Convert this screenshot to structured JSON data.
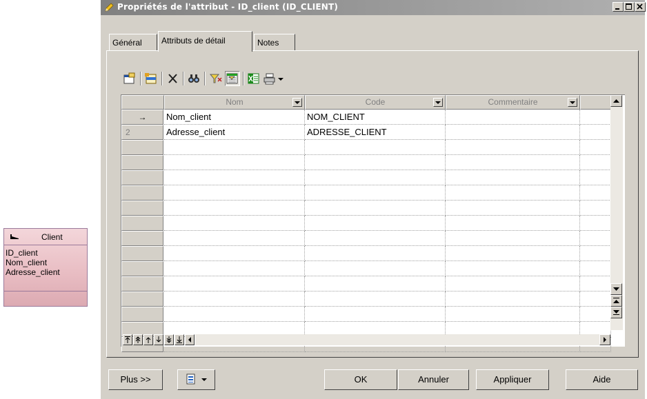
{
  "entity": {
    "title": "Client",
    "attributes": [
      "ID_client",
      "Nom_client",
      "Adresse_client"
    ]
  },
  "dialog": {
    "title": "Propriétés de l'attribut - ID_client (ID_CLIENT)",
    "window_buttons": {
      "minimize": "_",
      "maximize": "□",
      "close": "×"
    },
    "tabs": [
      {
        "label": "Général",
        "active": false
      },
      {
        "label": "Attributs de détail",
        "active": true
      },
      {
        "label": "Notes",
        "active": false
      }
    ],
    "toolbar": [
      "properties-icon",
      "add-row-icon",
      "delete-icon",
      "find-icon",
      "filter-icon",
      "customize-columns-icon",
      "excel-icon",
      "print-icon",
      "dropdown-arrow-icon"
    ],
    "grid": {
      "columns": [
        "Nom",
        "Code",
        "Commentaire"
      ],
      "current_row_marker": "→",
      "rows": [
        {
          "num": "",
          "nom": "Nom_client",
          "code": "NOM_CLIENT",
          "commentaire": ""
        },
        {
          "num": "2",
          "nom": "Adresse_client",
          "code": "ADRESSE_CLIENT",
          "commentaire": ""
        }
      ]
    },
    "buttons": {
      "plus": "Plus >>",
      "ok": "OK",
      "cancel": "Annuler",
      "apply": "Appliquer",
      "help": "Aide"
    },
    "colors": {
      "titlebar": "#808080",
      "face": "#d4d0c8",
      "entity_fill": "#e8bcc2"
    }
  }
}
